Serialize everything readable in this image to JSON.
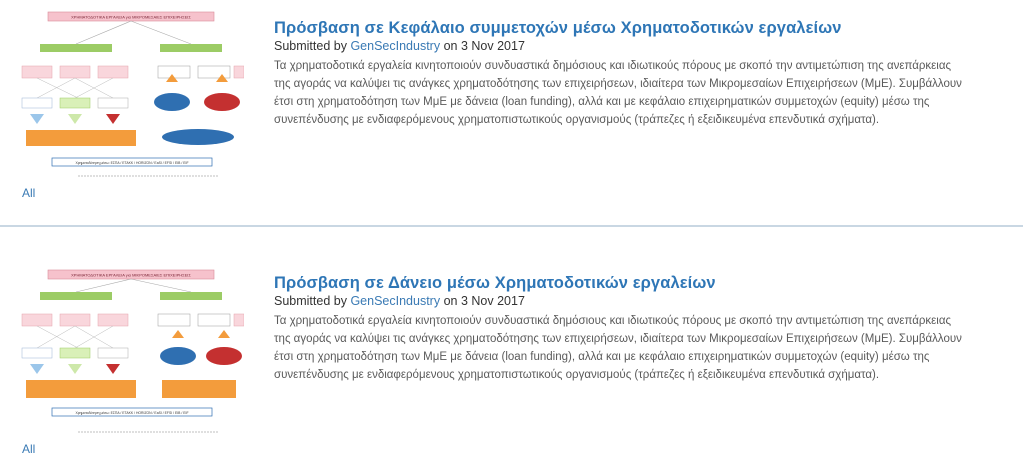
{
  "posts": [
    {
      "title": "Πρόσβαση σε Κεφάλαιο συμμετοχών μέσω Χρηματοδοτικών εργαλείων",
      "submitted_by_label": "Submitted by",
      "author": "GenSecIndustry",
      "on_label": "on",
      "date": "3 Nov 2017",
      "body_lines": [
        "Τα χρηματοδοτικά εργαλεία κινητοποιούν συνδυαστικά δημόσιους και ιδιωτικούς πόρους με σκοπό την αντιμετώπιση της ανεπάρκειας",
        "της αγοράς να καλύψει τις ανάγκες χρηματοδότησης των επιχειρήσεων, ιδιαίτερα των Μικρομεσαίων Επιχειρήσεων (ΜμΕ). Συμβάλλουν",
        "έτσι στη χρηματοδότηση των ΜμΕ με δάνεια (loan funding), αλλά και με κεφάλαιο επιχειρηματικών συμμετοχών (equity) μέσω της",
        "συνεπένδυσης με ενδιαφερόμενους χρηματοπιστωτικούς οργανισμούς (τράπεζες ή εξειδικευμένα επενδυτικά σχήματα)."
      ],
      "category": "All",
      "thumbnail": {
        "heading": "ΧΡΗΜΑΤΟΔΟΤΙΚΑ ΕΡΓΑΛΕΙΑ για ΜΙΚΡΟΜΕΣΑΙΕΣ ΕΠΙΧΕΙΡΗΣΕΙΣ",
        "footer": "Χρηματοδότηση μέσω: ΕΣΠΑ / ΕΤΑΚΚ / HORIZON / EaSI / EFSI / EIB / EIF"
      }
    },
    {
      "title": "Πρόσβαση σε Δάνειο μέσω Χρηματοδοτικών εργαλείων",
      "submitted_by_label": "Submitted by",
      "author": "GenSecIndustry",
      "on_label": "on",
      "date": "3 Nov 2017",
      "body_lines": [
        "Τα χρηματοδοτικά εργαλεία κινητοποιούν συνδυαστικά δημόσιους και ιδιωτικούς πόρους με σκοπό την αντιμετώπιση της ανεπάρκειας",
        "της αγοράς να καλύψει τις ανάγκες χρηματοδότησης των επιχειρήσεων, ιδιαίτερα των Μικρομεσαίων Επιχειρήσεων (ΜμΕ). Συμβάλλουν",
        "έτσι στη χρηματοδότηση των ΜμΕ με δάνεια (loan funding), αλλά και με κεφάλαιο επιχειρηματικών συμμετοχών (equity) μέσω της",
        "συνεπένδυσης με ενδιαφερόμενους χρηματοπιστωτικούς οργανισμούς (τράπεζες ή εξειδικευμένα επενδυτικά σχήματα)."
      ],
      "category": "All",
      "thumbnail": {
        "heading": "ΧΡΗΜΑΤΟΔΟΤΙΚΑ ΕΡΓΑΛΕΙΑ για ΜΙΚΡΟΜΕΣΑΙΕΣ ΕΠΙΧΕΙΡΗΣΕΙΣ",
        "footer": "Χρηματοδότηση μέσω: ΕΣΠΑ / ΕΤΑΚΚ / HORIZON / EaSI / EFSI / EIB / EIF"
      }
    }
  ],
  "colors": {
    "link": "#2e76b6",
    "text": "#5a5a5a",
    "separator": "#c9d7e3",
    "thumb_pink": "#f6c2cc",
    "thumb_green": "#9ccc65",
    "thumb_orange": "#f39c3c",
    "thumb_blue": "#2f6fb1"
  }
}
